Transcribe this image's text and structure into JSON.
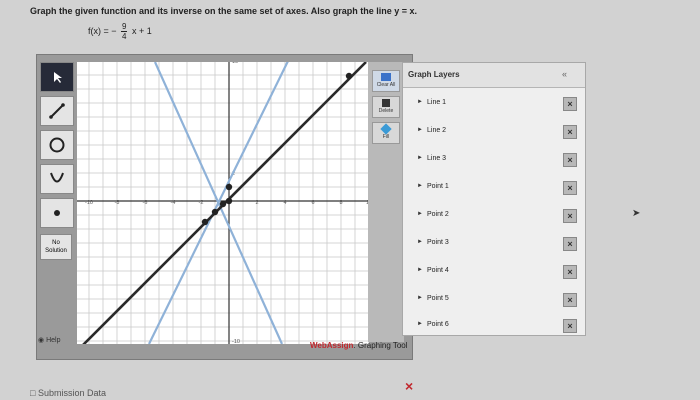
{
  "question": "Graph the given function and its inverse on the same set of axes. Also graph the line y = x.",
  "function": {
    "lhs": "f(x) = −",
    "numerator": "9",
    "denominator": "4",
    "rest": "x + 1"
  },
  "toolbar": {
    "tools": [
      "pointer-tool",
      "line-tool",
      "circle-tool",
      "parabola-tool",
      "point-tool"
    ],
    "no_solution_label": "No Solution",
    "help_label": "Help"
  },
  "graph": {
    "x_ticks": [
      "-10",
      "-8",
      "-6",
      "-4",
      "-2",
      "2",
      "4",
      "6",
      "8",
      "10"
    ],
    "y_ticks": [
      "10",
      "-10",
      "2"
    ]
  },
  "mid_tools": {
    "clear_all": "Clear All",
    "delete": "Delete",
    "fill": "Fill"
  },
  "branding": {
    "name": "WebAssign",
    "suffix": ". Graphing Tool"
  },
  "layers": {
    "title": "Graph Layers",
    "collapse": "«",
    "items": [
      "Line 1",
      "Line 2",
      "Line 3",
      "Point 1",
      "Point 2",
      "Point 3",
      "Point 4",
      "Point 5",
      "Point 6"
    ]
  },
  "footer": {
    "submission": "Submission Data",
    "close": "×"
  },
  "colors": {
    "dark_line": "#2a2a2a",
    "light_line": "#8fb2d8",
    "brand_red": "#c1272d"
  }
}
